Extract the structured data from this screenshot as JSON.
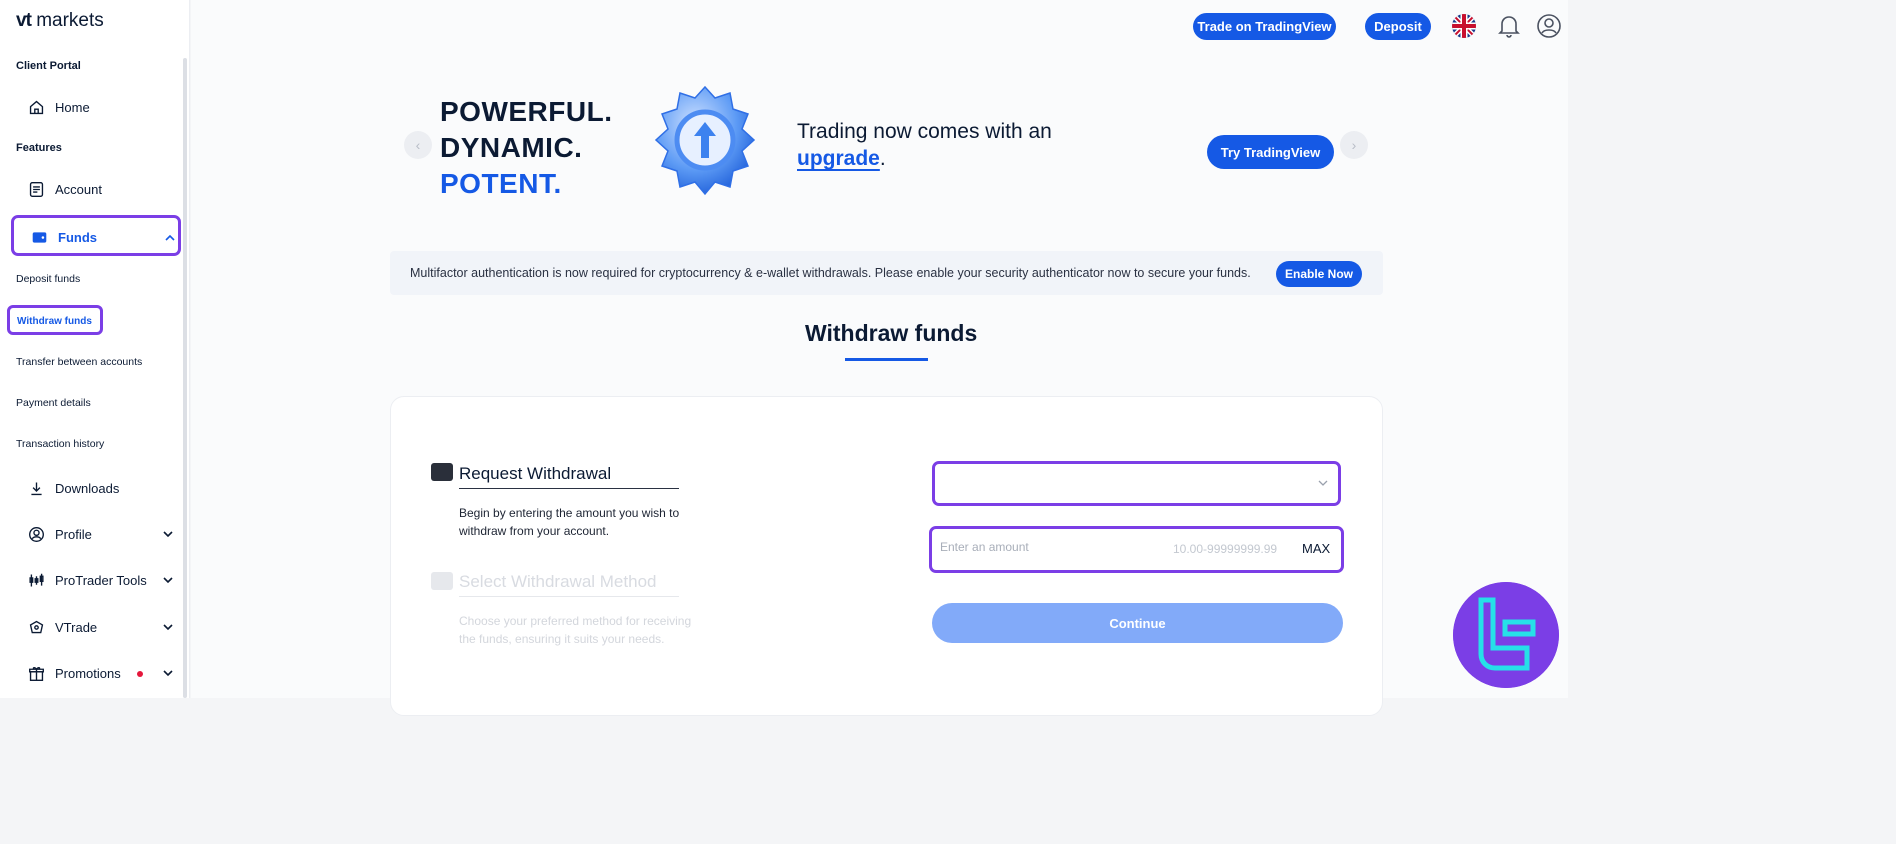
{
  "logo": {
    "brand_bold": "vt",
    "brand_light": "markets"
  },
  "sidebar": {
    "section_client": "Client Portal",
    "home": "Home",
    "section_features": "Features",
    "account": "Account",
    "funds": "Funds",
    "sub": {
      "deposit": "Deposit funds",
      "withdraw": "Withdraw funds",
      "transfer": "Transfer between accounts",
      "payment": "Payment details",
      "history": "Transaction history"
    },
    "downloads": "Downloads",
    "profile": "Profile",
    "protrader": "ProTrader Tools",
    "vtrade": "VTrade",
    "promotions": "Promotions"
  },
  "header": {
    "tradingview_btn": "Trade on TradingView",
    "deposit_btn": "Deposit"
  },
  "banner": {
    "line1": "POWERFUL.",
    "line2": "DYNAMIC.",
    "line3": "POTENT.",
    "tagline_pre": "Trading now comes with an",
    "tagline_link": "upgrade",
    "tagline_post": ".",
    "cta": "Try TradingView"
  },
  "notice": {
    "text": "Multifactor authentication is now required for cryptocurrency & e-wallet withdrawals. Please enable your security authenticator now to secure your funds.",
    "button": "Enable Now"
  },
  "page_title": "Withdraw funds",
  "form": {
    "step1_title": "Request Withdrawal",
    "step1_desc": "Begin by entering the amount you wish to withdraw from your account.",
    "step2_title": "Select Withdrawal Method",
    "step2_desc": "Choose your preferred method for receiving the funds, ensuring it suits your needs.",
    "amount_placeholder": "Enter an amount",
    "amount_range": "10.00-99999999.99",
    "max_label": "MAX",
    "continue_label": "Continue"
  },
  "colors": {
    "primary": "#1559e5",
    "highlight": "#7b3ee6",
    "disabled_button": "#82aaf9",
    "navy": "#0b1a33"
  }
}
